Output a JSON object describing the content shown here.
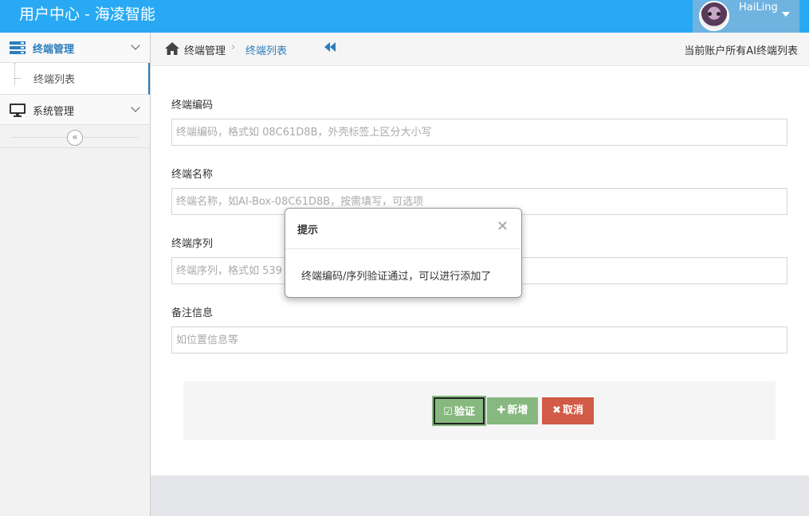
{
  "app": {
    "title": "用户中心 - 海凌智能"
  },
  "user": {
    "name": "HaiLing"
  },
  "sidebar": {
    "items": [
      {
        "label": "终端管理",
        "icon": "server-icon",
        "active": true
      },
      {
        "label": "终端列表",
        "icon": "",
        "sub": true
      },
      {
        "label": "系统管理",
        "icon": "desktop-icon",
        "active": false
      }
    ]
  },
  "breadcrumb": {
    "home": "终端管理",
    "current": "终端列表",
    "right_text": "当前账户所有AI终端列表"
  },
  "form": {
    "code_label": "终端编码",
    "code_placeholder": "终端编码，格式如 08C61D8B，外壳标签上区分大小写",
    "name_label": "终端名称",
    "name_placeholder": "终端名称，如AI-Box-08C61D8B，按需填写，可选项",
    "serial_label": "终端序列",
    "serial_placeholder": "终端序列，格式如 539",
    "note_label": "备注信息",
    "note_placeholder": "如位置信息等"
  },
  "actions": {
    "verify": "验证",
    "add": "新增",
    "cancel": "取消"
  },
  "modal": {
    "title": "提示",
    "close": "×",
    "message": "终端编码/序列验证通过，可以进行添加了"
  },
  "colors": {
    "navbar": "#29a9f3",
    "accent": "#2b7dbc",
    "success": "#87b87f",
    "danger": "#d15b47"
  }
}
